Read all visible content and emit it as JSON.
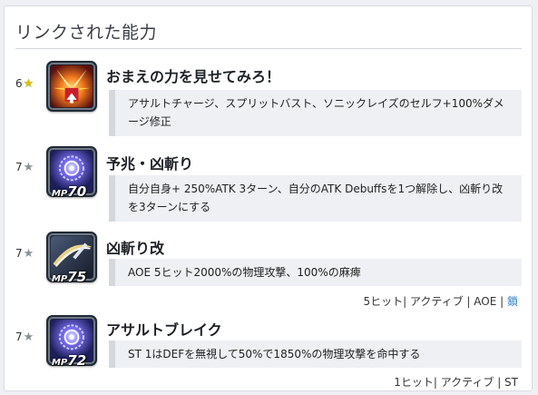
{
  "section": {
    "title": "リンクされた能力"
  },
  "abilities": [
    {
      "rank": "6",
      "star": "★",
      "star_style": "rainbow",
      "icon": "burst-attack-icon",
      "mp": "",
      "name": "おまえの力を見せてみろ！",
      "description": "アサルトチャージ、スプリットバスト、ソニックレイズのセルフ+100%ダメージ修正",
      "meta": ""
    },
    {
      "rank": "7",
      "star": "★",
      "star_style": "gray",
      "icon": "magic-vortex-icon",
      "mp": "70",
      "mp_label": "MP",
      "name": "予兆・凶斬り",
      "description": "自分自身+ 250%ATK 3ターン、自分のATK Debuffsを1つ解除し、凶斬り改を3ターンにする",
      "meta": ""
    },
    {
      "rank": "7",
      "star": "★",
      "star_style": "gray",
      "icon": "sword-slash-icon",
      "mp": "75",
      "mp_label": "MP",
      "name": "凶斬り改",
      "description": "AOE 5ヒット2000%の物理攻撃、100%の麻痺",
      "meta": "5ヒット| アクティブ | AOE | ",
      "meta_link": "鎖"
    },
    {
      "rank": "7",
      "star": "★",
      "star_style": "gray",
      "icon": "magic-vortex-icon",
      "mp": "72",
      "mp_label": "MP",
      "name": "アサルトブレイク",
      "description": "ST 1はDEFを無視して50%で1850%の物理攻撃を命中する",
      "meta": "1ヒット| アクティブ | ST"
    }
  ],
  "colors": {
    "link": "#2a7fc1",
    "icon_frame": "#202a36",
    "desc_bg": "#eef0f3"
  }
}
